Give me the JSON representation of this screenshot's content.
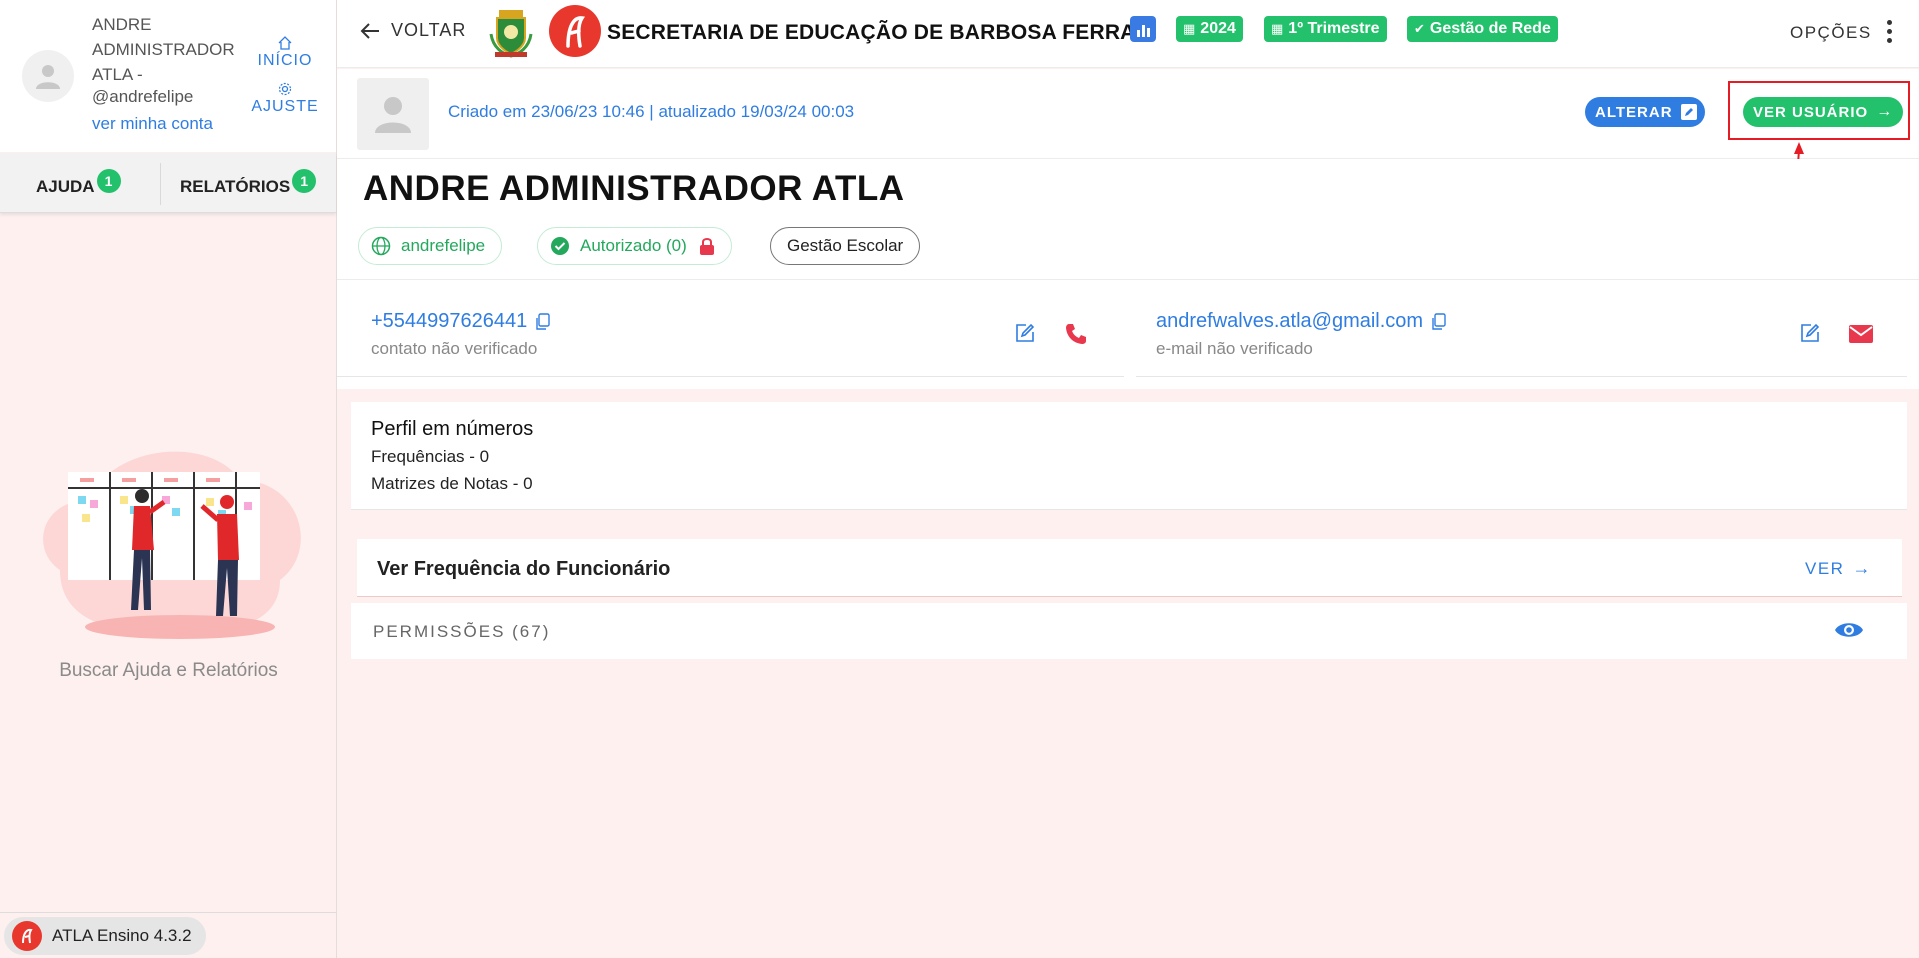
{
  "sidebar": {
    "user_name": "ANDRE ADMINISTRADOR ATLA -",
    "user_handle": "@andrefelipe",
    "my_account": "ver minha conta",
    "home_label": "INÍCIO",
    "settings_label": "AJUSTE",
    "tabs": [
      {
        "label": "AJUDA",
        "badge": "1"
      },
      {
        "label": "RELATÓRIOS",
        "badge": "1"
      }
    ],
    "help_text": "Buscar Ajuda e Relatórios",
    "version": "ATLA Ensino 4.3.2"
  },
  "header": {
    "back_label": "VOLTAR",
    "title": "SECRETARIA DE EDUCAÇÃO DE BARBOSA FERRAZ",
    "year": "2024",
    "period": "1º Trimestre",
    "scope": "Gestão de Rede",
    "options_label": "OPÇÕES"
  },
  "profile": {
    "created_text": "Criado em 23/06/23 10:46 | atualizado 19/03/24 00:03",
    "edit_button": "ALTERAR",
    "view_user_button": "VER USUÁRIO",
    "name": "ANDRE ADMINISTRADOR ATLA",
    "username": "andrefelipe",
    "authorized": "Autorizado (0)",
    "role": "Gestão Escolar"
  },
  "contacts": {
    "phone": "+5544997626441",
    "phone_status": "contato não verificado",
    "email": "andrefwalves.atla@gmail.com",
    "email_status": "e-mail não verificado"
  },
  "stats": {
    "title": "Perfil em números",
    "frequencies": "Frequências - 0",
    "grade_matrices": "Matrizes de Notas - 0"
  },
  "attendance": {
    "title": "Ver Frequência do Funcionário",
    "link": "VER"
  },
  "permissions": {
    "label": "PERMISSÕES (67)"
  },
  "colors": {
    "accent_blue": "#2f7de1",
    "accent_green": "#23c16b",
    "brand_red": "#e8382e",
    "highlight_red": "#e51c23"
  }
}
